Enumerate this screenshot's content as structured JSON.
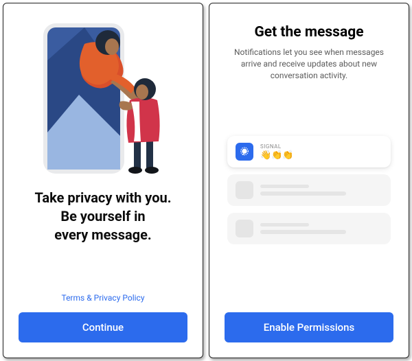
{
  "screen1": {
    "headline_l1": "Take privacy with you.",
    "headline_l2": "Be yourself in",
    "headline_l3": "every message.",
    "terms_label": "Terms & Privacy Policy",
    "continue_label": "Continue"
  },
  "screen2": {
    "title": "Get the message",
    "subtitle": "Notifications let you see when messages arrive and receive updates about new conversation activity.",
    "notification": {
      "app_name": "SIGNAL",
      "message": "👋👏👏"
    },
    "enable_label": "Enable Permissions"
  },
  "colors": {
    "accent": "#2C6BED"
  }
}
